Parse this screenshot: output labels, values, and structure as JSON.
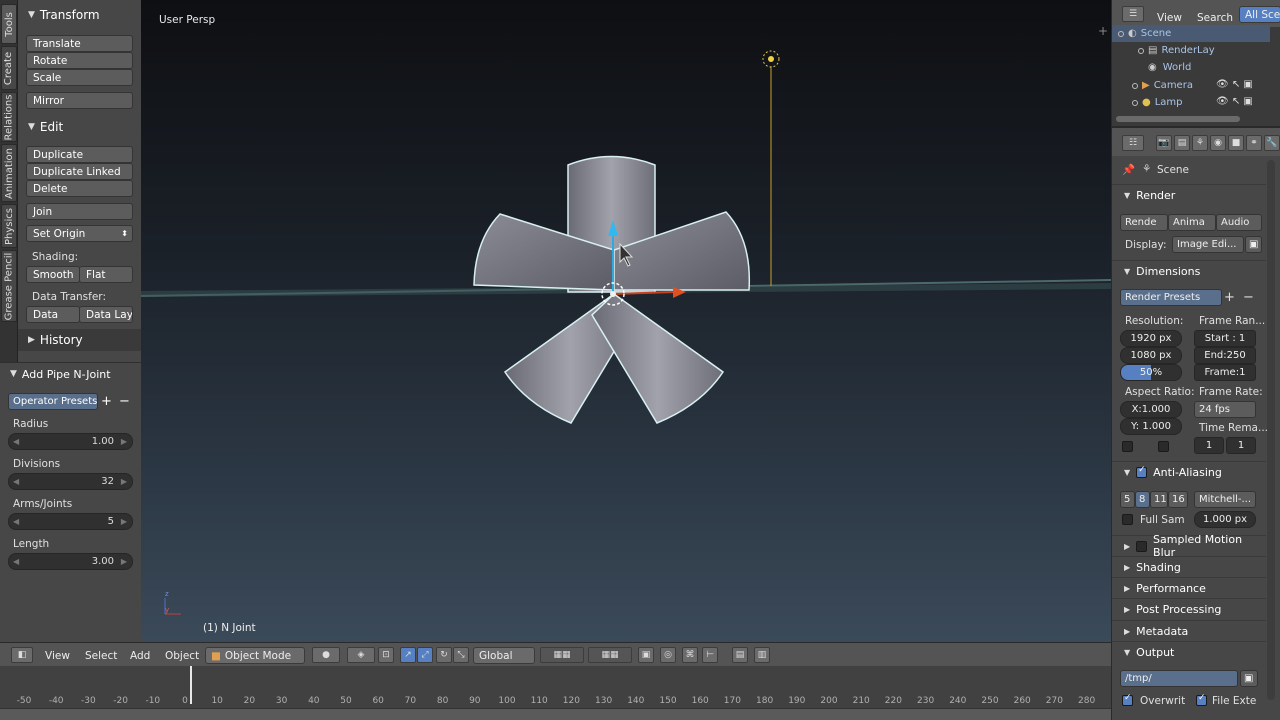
{
  "tabs": [
    "Tools",
    "Create",
    "Relations",
    "Animation",
    "Physics",
    "Grease Pencil"
  ],
  "tools": {
    "transform_title": "Transform",
    "translate": "Translate",
    "rotate": "Rotate",
    "scale": "Scale",
    "mirror": "Mirror",
    "edit_title": "Edit",
    "duplicate": "Duplicate",
    "duplicate_linked": "Duplicate Linked",
    "delete": "Delete",
    "join": "Join",
    "set_origin": "Set Origin",
    "shading_label": "Shading:",
    "smooth": "Smooth",
    "flat": "Flat",
    "data_transfer_label": "Data Transfer:",
    "data": "Data",
    "data_layo": "Data Layo",
    "history_title": "History"
  },
  "operator": {
    "title": "Add Pipe N-Joint",
    "presets": "Operator Presets",
    "radius_label": "Radius",
    "radius_value": "1.00",
    "divisions_label": "Divisions",
    "divisions_value": "32",
    "arms_label": "Arms/Joints",
    "arms_value": "5",
    "length_label": "Length",
    "length_value": "3.00"
  },
  "viewport": {
    "perspective": "User Persp",
    "object_info": "(1) N Joint"
  },
  "header": {
    "view": "View",
    "select": "Select",
    "add": "Add",
    "object": "Object",
    "mode": "Object Mode",
    "orientation": "Global"
  },
  "timeline": {
    "ticks": [
      "-50",
      "-40",
      "-30",
      "-20",
      "-10",
      "0",
      "10",
      "20",
      "30",
      "40",
      "50",
      "60",
      "70",
      "80",
      "90",
      "100",
      "110",
      "120",
      "130",
      "140",
      "150",
      "160",
      "170",
      "180",
      "190",
      "200",
      "210",
      "220",
      "230",
      "240",
      "250",
      "260",
      "270",
      "280"
    ]
  },
  "outliner": {
    "view": "View",
    "search": "Search",
    "all_scenes": "All Scen",
    "items": [
      "Scene",
      "RenderLay",
      "World",
      "Camera",
      "Lamp"
    ]
  },
  "props": {
    "scene": "Scene",
    "render": "Render",
    "rende_btn": "Rende",
    "anima_btn": "Anima",
    "audio_btn": "Audio",
    "display_label": "Display:",
    "display_value": "Image Edi...",
    "dimensions": "Dimensions",
    "render_presets": "Render Presets",
    "resolution_label": "Resolution:",
    "res_x": "1920 px",
    "res_y": "1080 px",
    "res_pct": "50%",
    "frame_range_label": "Frame Ran...",
    "start": "Start : 1",
    "end": "End:250",
    "frame": "Frame:1",
    "aspect_label": "Aspect Ratio:",
    "aspect_x": "X:1.000",
    "aspect_y": "Y: 1.000",
    "frame_rate_label": "Frame Rate:",
    "fps": "24 fps",
    "time_rema": "Time Rema...",
    "time_a": "1",
    "time_b": "1",
    "anti_aliasing": "Anti-Aliasing",
    "aa_5": "5",
    "aa_8": "8",
    "aa_11": "11",
    "aa_16": "16",
    "filter": "Mitchell-...",
    "full_sam": "Full Sam",
    "filter_size": "1.000 px",
    "motion_blur": "Sampled Motion Blur",
    "shading": "Shading",
    "performance": "Performance",
    "post_processing": "Post Processing",
    "metadata": "Metadata",
    "output": "Output",
    "output_path": "/tmp/",
    "overwrite": "Overwrit",
    "file_ext": "File Exte"
  },
  "colors": {
    "accent": "#5680c2",
    "selected": "#5a6f8c",
    "mesh": "#8a8a94",
    "outline": "#d8f0f0"
  }
}
